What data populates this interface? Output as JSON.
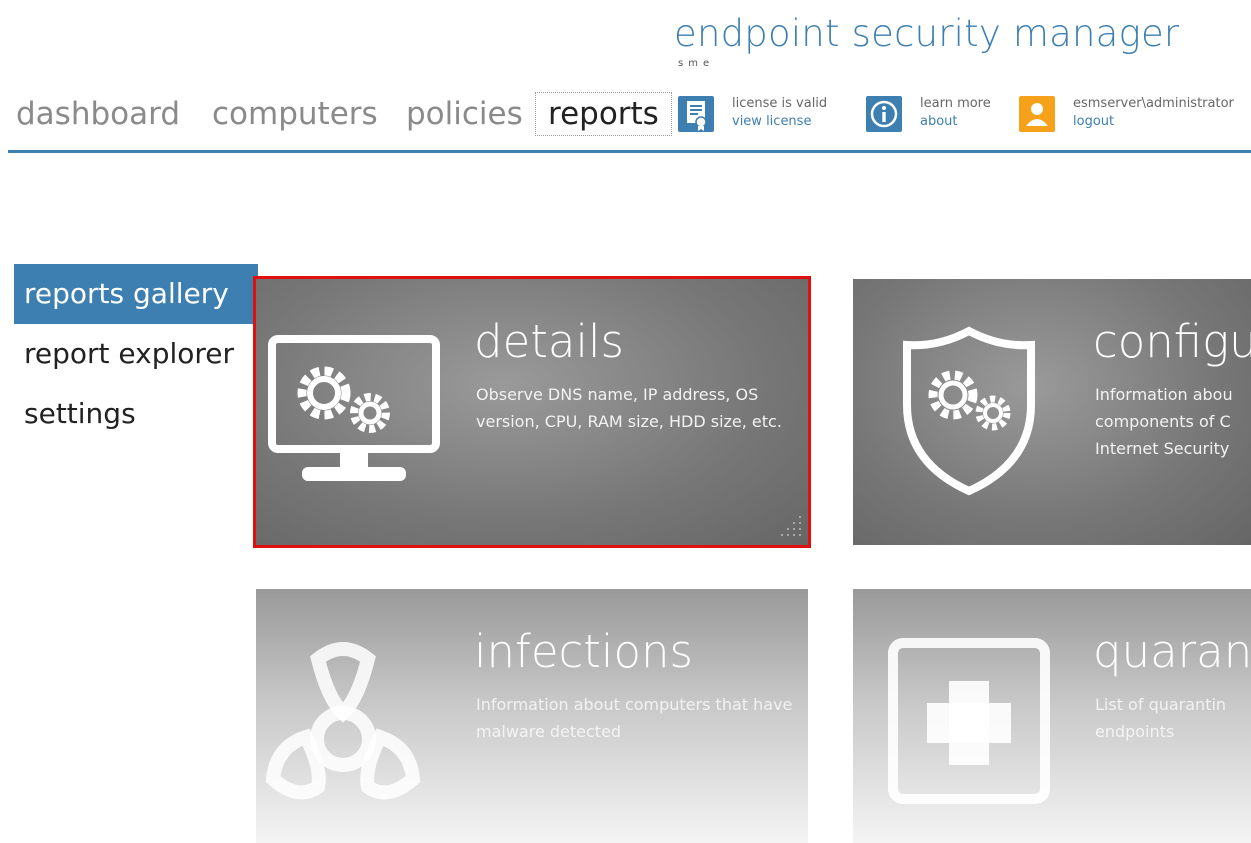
{
  "header": {
    "app_title": "endpoint security manager",
    "app_subtitle": "sme"
  },
  "nav": {
    "items": [
      {
        "label": "dashboard"
      },
      {
        "label": "computers"
      },
      {
        "label": "policies"
      },
      {
        "label": "reports"
      }
    ],
    "active": "reports"
  },
  "status": {
    "license": {
      "text": "license is valid",
      "link": "view license",
      "icon": "certificate-icon"
    },
    "about": {
      "text": "learn more",
      "link": "about",
      "icon": "info-icon"
    },
    "user": {
      "text": "esmserver\\administrator",
      "link": "logout",
      "icon": "user-icon"
    }
  },
  "sidebar": {
    "items": [
      {
        "label": "reports gallery"
      },
      {
        "label": "report explorer"
      },
      {
        "label": "settings"
      }
    ],
    "active": "reports gallery"
  },
  "tiles": [
    {
      "title": "details",
      "description": "Observe DNS name, IP address, OS version, CPU, RAM size, HDD size, etc.",
      "icon": "monitor-gears-icon",
      "selected": true
    },
    {
      "title": "configu",
      "description": "Information abou components of C Internet Security",
      "icon": "shield-gears-icon"
    },
    {
      "title": "infections",
      "description": "Information about computers that have malware detected",
      "icon": "biohazard-icon"
    },
    {
      "title": "quarant",
      "description": "List of quarantin endpoints",
      "icon": "medical-cross-icon"
    }
  ],
  "colors": {
    "accent": "#3d7fb0",
    "selection": "#e01010",
    "user_icon": "#f5a21a"
  }
}
